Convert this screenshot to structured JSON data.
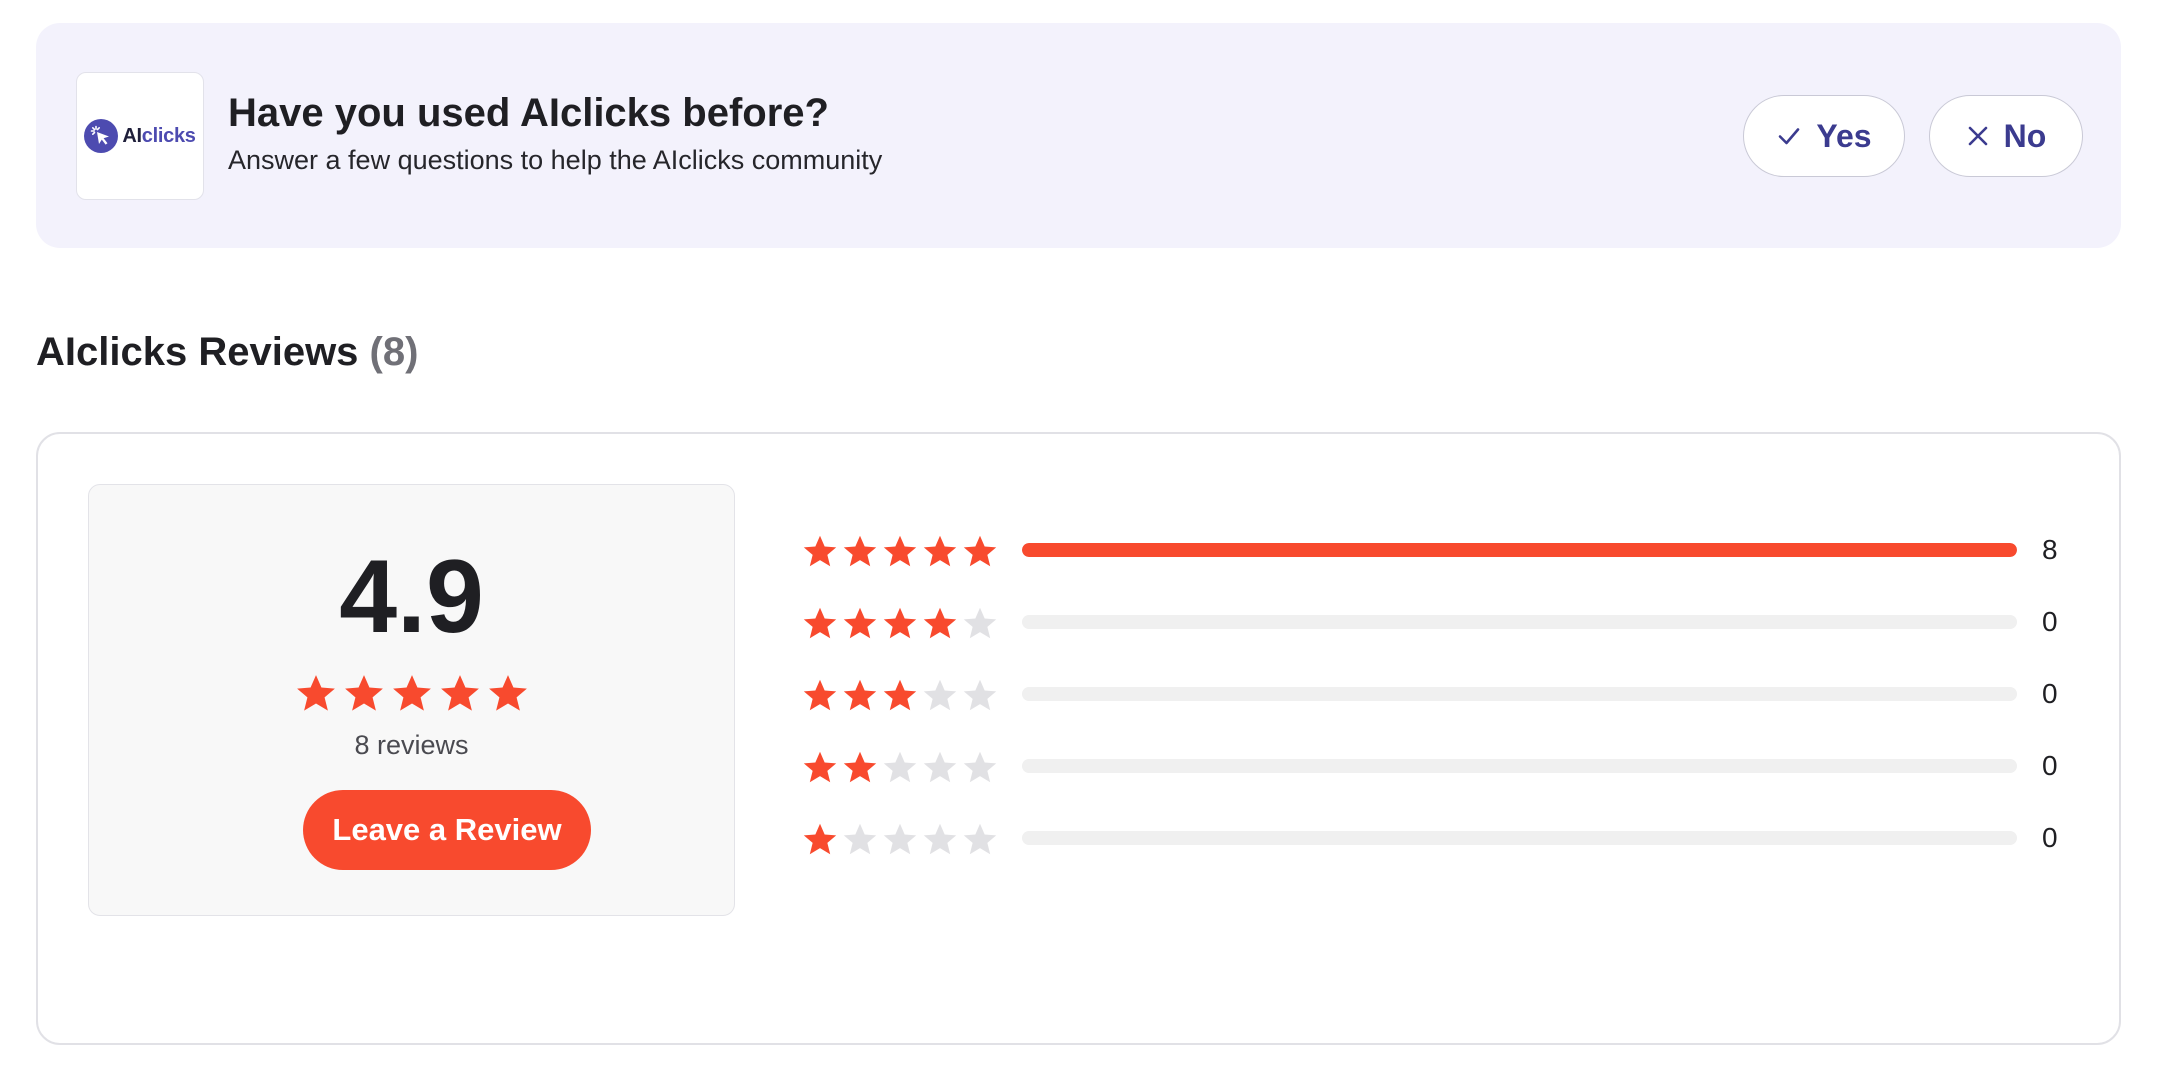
{
  "banner": {
    "logo_name": "AIclicks",
    "logo_prefix": "AI",
    "logo_suffix": "clicks",
    "title": "Have you used AIclicks before?",
    "subtitle": "Answer a few questions to help the AIclicks community",
    "yes_label": "Yes",
    "no_label": "No"
  },
  "reviews": {
    "heading_title": "AIclicks Reviews",
    "heading_count": "(8)",
    "score": "4.9",
    "score_stars": 5,
    "review_count_label": "8 reviews",
    "leave_review_label": "Leave a Review",
    "distribution": [
      {
        "stars": 5,
        "count": "8",
        "fraction": 1.0
      },
      {
        "stars": 4,
        "count": "0",
        "fraction": 0
      },
      {
        "stars": 3,
        "count": "0",
        "fraction": 0
      },
      {
        "stars": 2,
        "count": "0",
        "fraction": 0
      },
      {
        "stars": 1,
        "count": "0",
        "fraction": 0
      }
    ]
  },
  "colors": {
    "accent": "#f84a2e",
    "brand": "#4d4bb0",
    "star_empty": "#e1e1e4",
    "banner_bg": "#f3f2fc"
  },
  "icons": {
    "logo": "cursor-click-icon",
    "yes": "check-icon",
    "no": "close-icon",
    "star": "star-icon"
  }
}
